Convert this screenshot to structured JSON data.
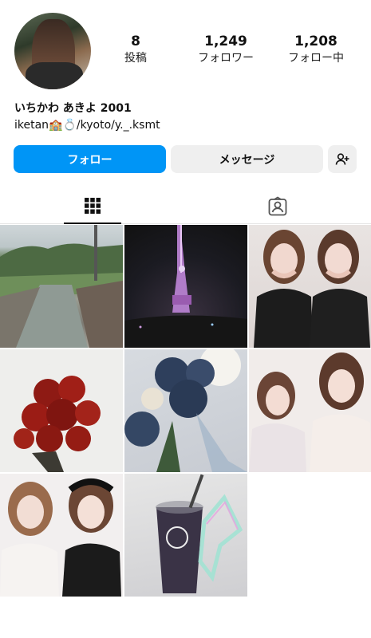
{
  "profile": {
    "name": "いちかわ あきよ 2001",
    "bio": "iketan🏫💍/kyoto/y._.ksmt"
  },
  "stats": {
    "posts": {
      "value": "8",
      "label": "投稿"
    },
    "followers": {
      "value": "1,249",
      "label": "フォロワー"
    },
    "following": {
      "value": "1,208",
      "label": "フォロー中"
    }
  },
  "actions": {
    "follow_label": "フォロー",
    "message_label": "メッセージ",
    "add_user_icon": "person-plus-icon"
  },
  "tabs": [
    {
      "name": "posts-grid",
      "icon": "grid-icon",
      "active": true
    },
    {
      "name": "tagged",
      "icon": "tagged-person-icon",
      "active": false
    }
  ],
  "colors": {
    "accent": "#0095f6",
    "secondary_button": "#efefef"
  },
  "posts": [
    {
      "description": "river"
    },
    {
      "description": "tower-at-night"
    },
    {
      "description": "two-girls"
    },
    {
      "description": "red-roses"
    },
    {
      "description": "blue-roses"
    },
    {
      "description": "two-girls-poses"
    },
    {
      "description": "two-girls-headbands"
    },
    {
      "description": "drink-cup-neon"
    }
  ]
}
